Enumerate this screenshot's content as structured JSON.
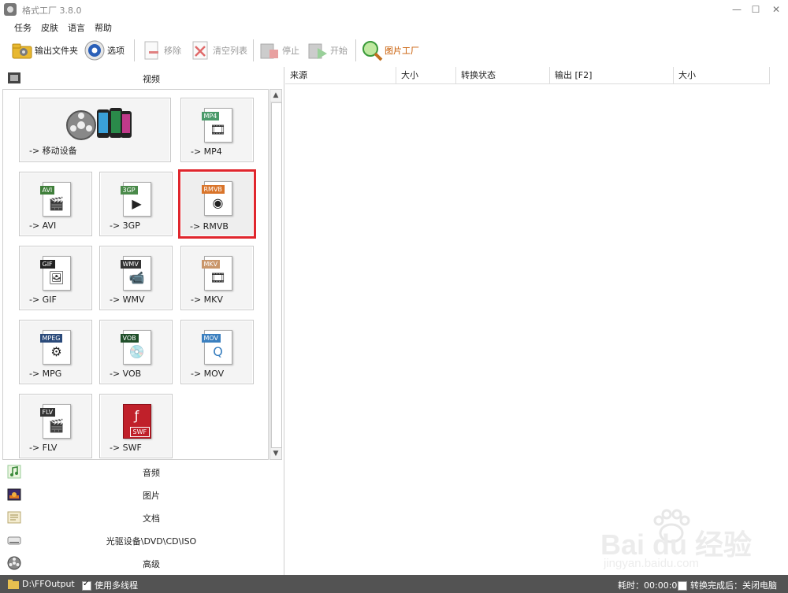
{
  "window": {
    "title": "格式工厂 3.8.0",
    "minimize": "—",
    "maximize": "☐",
    "close": "✕"
  },
  "menu": [
    "任务",
    "皮肤",
    "语言",
    "帮助"
  ],
  "toolbar": {
    "output_folder": "输出文件夹",
    "options": "选项",
    "remove": "移除",
    "clear_list": "清空列表",
    "stop": "停止",
    "start": "开始",
    "picture_factory": "图片工厂"
  },
  "categories": {
    "video": "视频",
    "audio": "音频",
    "picture": "图片",
    "document": "文档",
    "rom": "光驱设备\\DVD\\CD\\ISO",
    "advanced": "高级"
  },
  "tiles": [
    {
      "label": "-> 移动设备",
      "tag": ""
    },
    {
      "label": "-> MP4",
      "tag": "MP4",
      "color": "#4a9a6a"
    },
    {
      "label": "-> AVI",
      "tag": "AVI",
      "color": "#3f7f3a"
    },
    {
      "label": "-> 3GP",
      "tag": "3GP",
      "color": "#4a8a4a"
    },
    {
      "label": "-> RMVB",
      "tag": "RMVB",
      "color": "#d9742a"
    },
    {
      "label": "-> GIF",
      "tag": "GIF",
      "color": "#222222"
    },
    {
      "label": "-> WMV",
      "tag": "WMV",
      "color": "#333333"
    },
    {
      "label": "-> MKV",
      "tag": "MKV",
      "color": "#c9966a"
    },
    {
      "label": "-> MPG",
      "tag": "MPEG",
      "color": "#2a4a7a"
    },
    {
      "label": "-> VOB",
      "tag": "VOB",
      "color": "#1f4f2a"
    },
    {
      "label": "-> MOV",
      "tag": "MOV",
      "color": "#3a7fbf"
    },
    {
      "label": "-> FLV",
      "tag": "FLV",
      "color": "#333333"
    },
    {
      "label": "-> SWF",
      "tag": "SWF",
      "color": "#c0202a"
    }
  ],
  "columns": [
    "来源",
    "大小",
    "转换状态",
    "输出 [F2]",
    "大小"
  ],
  "status": {
    "output_path": "D:\\FFOutput",
    "multithread": "使用多线程",
    "elapsed": "耗时：00:00:00",
    "after_convert": "转换完成后：关闭电脑"
  },
  "watermark": {
    "brand": "Bai du 经验",
    "url": "jingyan.baidu.com"
  },
  "colors": {
    "selected_border": "#e0262d",
    "statusbar": "#535353"
  }
}
